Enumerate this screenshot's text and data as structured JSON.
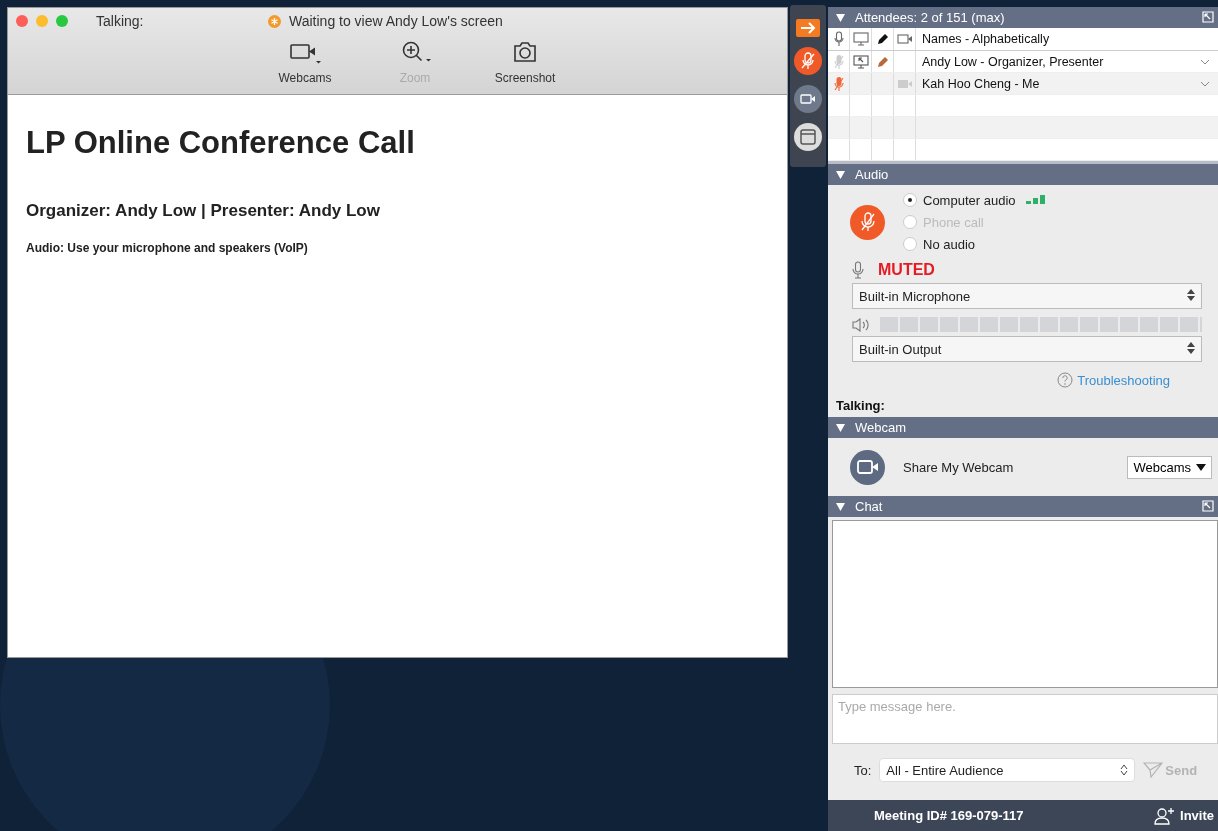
{
  "main_window": {
    "talking_label": "Talking:",
    "status": "Waiting to view Andy Low's screen",
    "toolbar": [
      {
        "label": "Webcams",
        "kind": "webcam",
        "disabled": false
      },
      {
        "label": "Zoom",
        "kind": "zoom",
        "disabled": true
      },
      {
        "label": "Screenshot",
        "kind": "camera",
        "disabled": false
      }
    ],
    "title": "LP Online Conference Call",
    "subtitle": "Organizer: Andy Low | Presenter: Andy Low",
    "audio_note": "Audio: Use your microphone and speakers (VoIP)"
  },
  "attendees": {
    "title": "Attendees: 2 of 151 (max)",
    "header": "Names - Alphabetically",
    "rows": [
      {
        "name": "Andy Low - Organizer, Presenter",
        "mic_muted": false,
        "presenter": true,
        "drawing": true,
        "webcam": false
      },
      {
        "name": "Kah Hoo Cheng - Me",
        "mic_muted": true,
        "presenter": false,
        "drawing": false,
        "webcam": true
      }
    ]
  },
  "audio": {
    "title": "Audio",
    "mic_muted": true,
    "options": [
      {
        "label": "Computer audio",
        "selected": true,
        "disabled": false
      },
      {
        "label": "Phone call",
        "selected": false,
        "disabled": true
      },
      {
        "label": "No audio",
        "selected": false,
        "disabled": false
      }
    ],
    "mic_status": "MUTED",
    "microphone": "Built-in Microphone",
    "speaker_meter": {
      "level": 0
    },
    "output": "Built-in Output",
    "help_link": "Troubleshooting",
    "talking_label": "Talking:"
  },
  "webcam": {
    "title": "Webcam",
    "label": "Share My Webcam",
    "dropdown": "Webcams"
  },
  "chat": {
    "title": "Chat",
    "placeholder": "Type message here.",
    "to_label": "To:",
    "recipient": "All - Entire Audience",
    "send": "Send",
    "send_disabled": true
  },
  "footer": {
    "meeting_id": "Meeting ID# 169-079-117",
    "invite": "Invite"
  }
}
